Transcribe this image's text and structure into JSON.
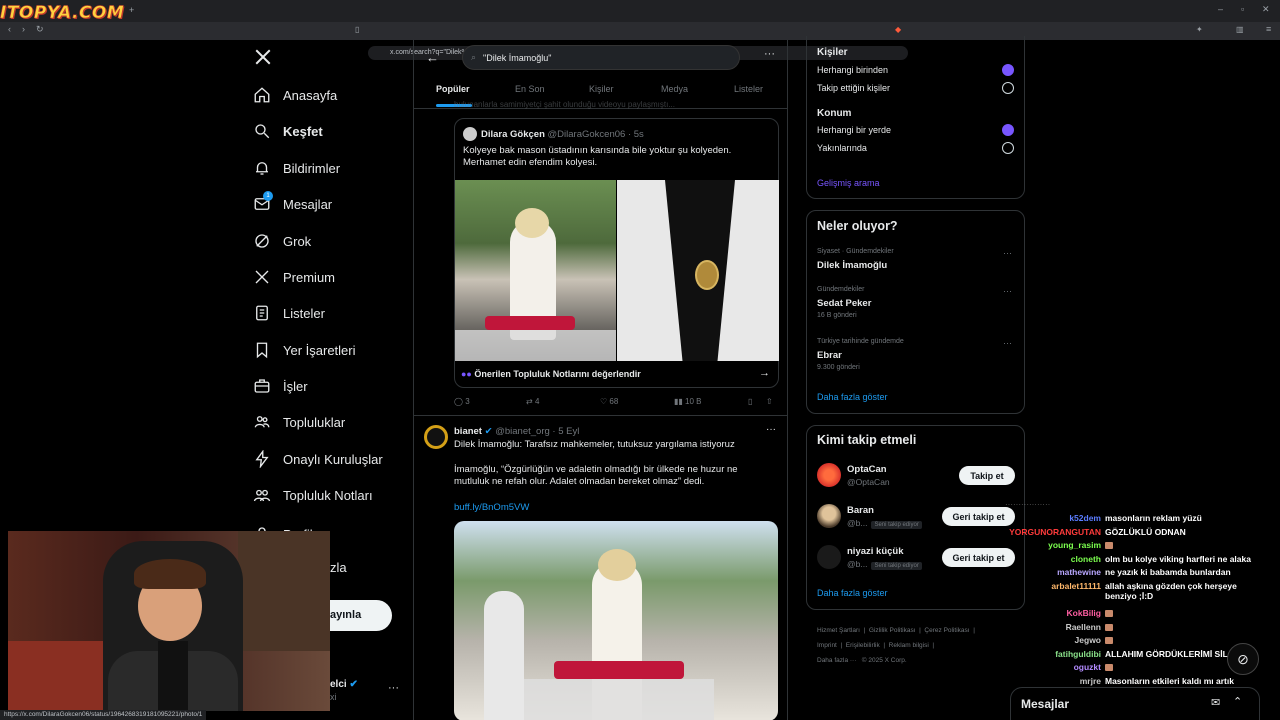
{
  "browser": {
    "logo_text": "ITOPYA.COM",
    "url": "x.com/search?q=\"Dilek%20İmamoğlu\"&src=trend_click&vertical=trends",
    "status_url": "https://x.com/DilaraGokcen06/status/1964268319181095221/photo/1"
  },
  "nav": {
    "items": [
      "Anasayfa",
      "Keşfet",
      "Bildirimler",
      "Mesajlar",
      "Grok",
      "Premium",
      "Listeler",
      "Yer İşaretleri",
      "İşler",
      "Topluluklar",
      "Onaylı Kuruluşlar",
      "Topluluk Notları"
    ],
    "active": "Keşfet",
    "message_badge": "1",
    "partial_profile": "Profil",
    "partial_more": "zla",
    "post_button": "ayınla",
    "account_suffix": "elci",
    "account_handle_suffix": "xi",
    "more_dots": "···"
  },
  "search": {
    "query": "\"Dilek İmamoğlu\"",
    "tabs": [
      "Popüler",
      "En Son",
      "Kişiler",
      "Medya",
      "Listeler"
    ],
    "active_tab": "Popüler"
  },
  "feed": {
    "truncated_line": "bulunanlarla samimiyetçi şahit olunduğu videoyu paylaşmıştı...",
    "quoted": {
      "name": "Dilara Gökçen",
      "handle": "@DilaraGokcen06",
      "time": "5s",
      "text": "Kolyeye bak mason üstadının karısında bile yoktur şu kolyeden. Merhamet edin efendim kolyesi.",
      "community_notes": "Önerilen Topluluk Notlarını değerlendir"
    },
    "actions1": {
      "replies": "3",
      "reposts": "4",
      "likes": "68",
      "views": "10 B"
    },
    "post2": {
      "name": "bianet",
      "handle": "@bianet_org",
      "time": "5 Eyl",
      "line1": "Dilek İmamoğlu: Tarafsız mahkemeler, tutuksuz yargılama istiyoruz",
      "line2": "İmamoğlu, “Özgürlüğün ve adaletin olmadığı bir ülkede ne huzur ne mutluluk ne refah olur. Adalet olmadan bereket olmaz” dedi.",
      "link": "buff.ly/BnOm5VW"
    }
  },
  "filters": {
    "people_title": "Kişiler",
    "people_opts": [
      "Herhangi birinden",
      "Takip ettiğin kişiler"
    ],
    "location_title": "Konum",
    "location_opts": [
      "Herhangi bir yerde",
      "Yakınlarında"
    ],
    "advanced": "Gelişmiş arama"
  },
  "trends": {
    "title": "Neler oluyor?",
    "items": [
      {
        "context": "Siyaset · Gündemdekiler",
        "name": "Dilek İmamoğlu",
        "count": ""
      },
      {
        "context": "Gündemdekiler",
        "name": "Sedat Peker",
        "count": "16 B gönderi"
      },
      {
        "context": "Türkiye tarihinde gündemde",
        "name": "Ebrar",
        "count": "9.300 gönderi"
      }
    ],
    "more": "Daha fazla göster"
  },
  "who_to_follow": {
    "title": "Kimi takip etmeli",
    "items": [
      {
        "name": "OptaCan",
        "handle": "@OptaCan",
        "button": "Takip et",
        "follows_you": ""
      },
      {
        "name": "Baran",
        "handle": "@b...",
        "button": "Geri takip et",
        "follows_you": "Seni takip ediyor"
      },
      {
        "name": "niyazi küçük",
        "handle": "@b...",
        "button": "Geri takip et",
        "follows_you": "Seni takip ediyor"
      }
    ],
    "more": "Daha fazla göster"
  },
  "footer": {
    "links": [
      "Hizmet Şartları",
      "Gizlilik Politikası",
      "Çerez Politikası",
      "Imprint",
      "Erişilebilirlik",
      "Reklam bilgisi",
      "Daha fazla ···"
    ],
    "copyright": "© 2025 X Corp."
  },
  "messages_bar": {
    "label": "Mesajlar"
  },
  "chat": [
    {
      "user": "k52dem",
      "color": "#5b7cff",
      "msg": "masonların reklam yüzü",
      "emote": false
    },
    {
      "user": "YORGUNORANGUTAN",
      "color": "#ff3b3b",
      "msg": "GÖZLÜKLÜ ODNAN",
      "emote": false
    },
    {
      "user": "young_rasim",
      "color": "#7cff4f",
      "msg": "",
      "emote": true
    },
    {
      "user": "cloneth",
      "color": "#7cff4f",
      "msg": "olm bu kolye viking harfleri ne alaka",
      "emote": false
    },
    {
      "user": "mathewine",
      "color": "#b9a7ff",
      "msg": "ne yazık ki babamda bunlardan",
      "emote": false
    },
    {
      "user": "arbalet11111",
      "color": "#ffb86b",
      "msg": "allah aşkına gözden çok herşeye benziyo ;İ:D",
      "emote": false
    },
    {
      "user": "KokBilig",
      "color": "#ff5fa2",
      "msg": "",
      "emote": true
    },
    {
      "user": "Raellenn",
      "color": "#c9c9c9",
      "msg": "",
      "emote": true
    },
    {
      "user": "Jegwo",
      "color": "#c9c9c9",
      "msg": "",
      "emote": true
    },
    {
      "user": "fatihguldibi",
      "color": "#8be28b",
      "msg": "ALLAHIM GÖRDÜKLERİMİ SİL",
      "emote": false
    },
    {
      "user": "oguzkt",
      "color": "#b38bff",
      "msg": "",
      "emote": true
    },
    {
      "user": "mrjre",
      "color": "#c9c9c9",
      "msg": "Masonların etkileri kaldı mı artık",
      "emote": false
    }
  ],
  "colors": {
    "accent": "#1d9bf0",
    "grok_purple": "#7856ff",
    "verified": "#1d9bf0"
  }
}
